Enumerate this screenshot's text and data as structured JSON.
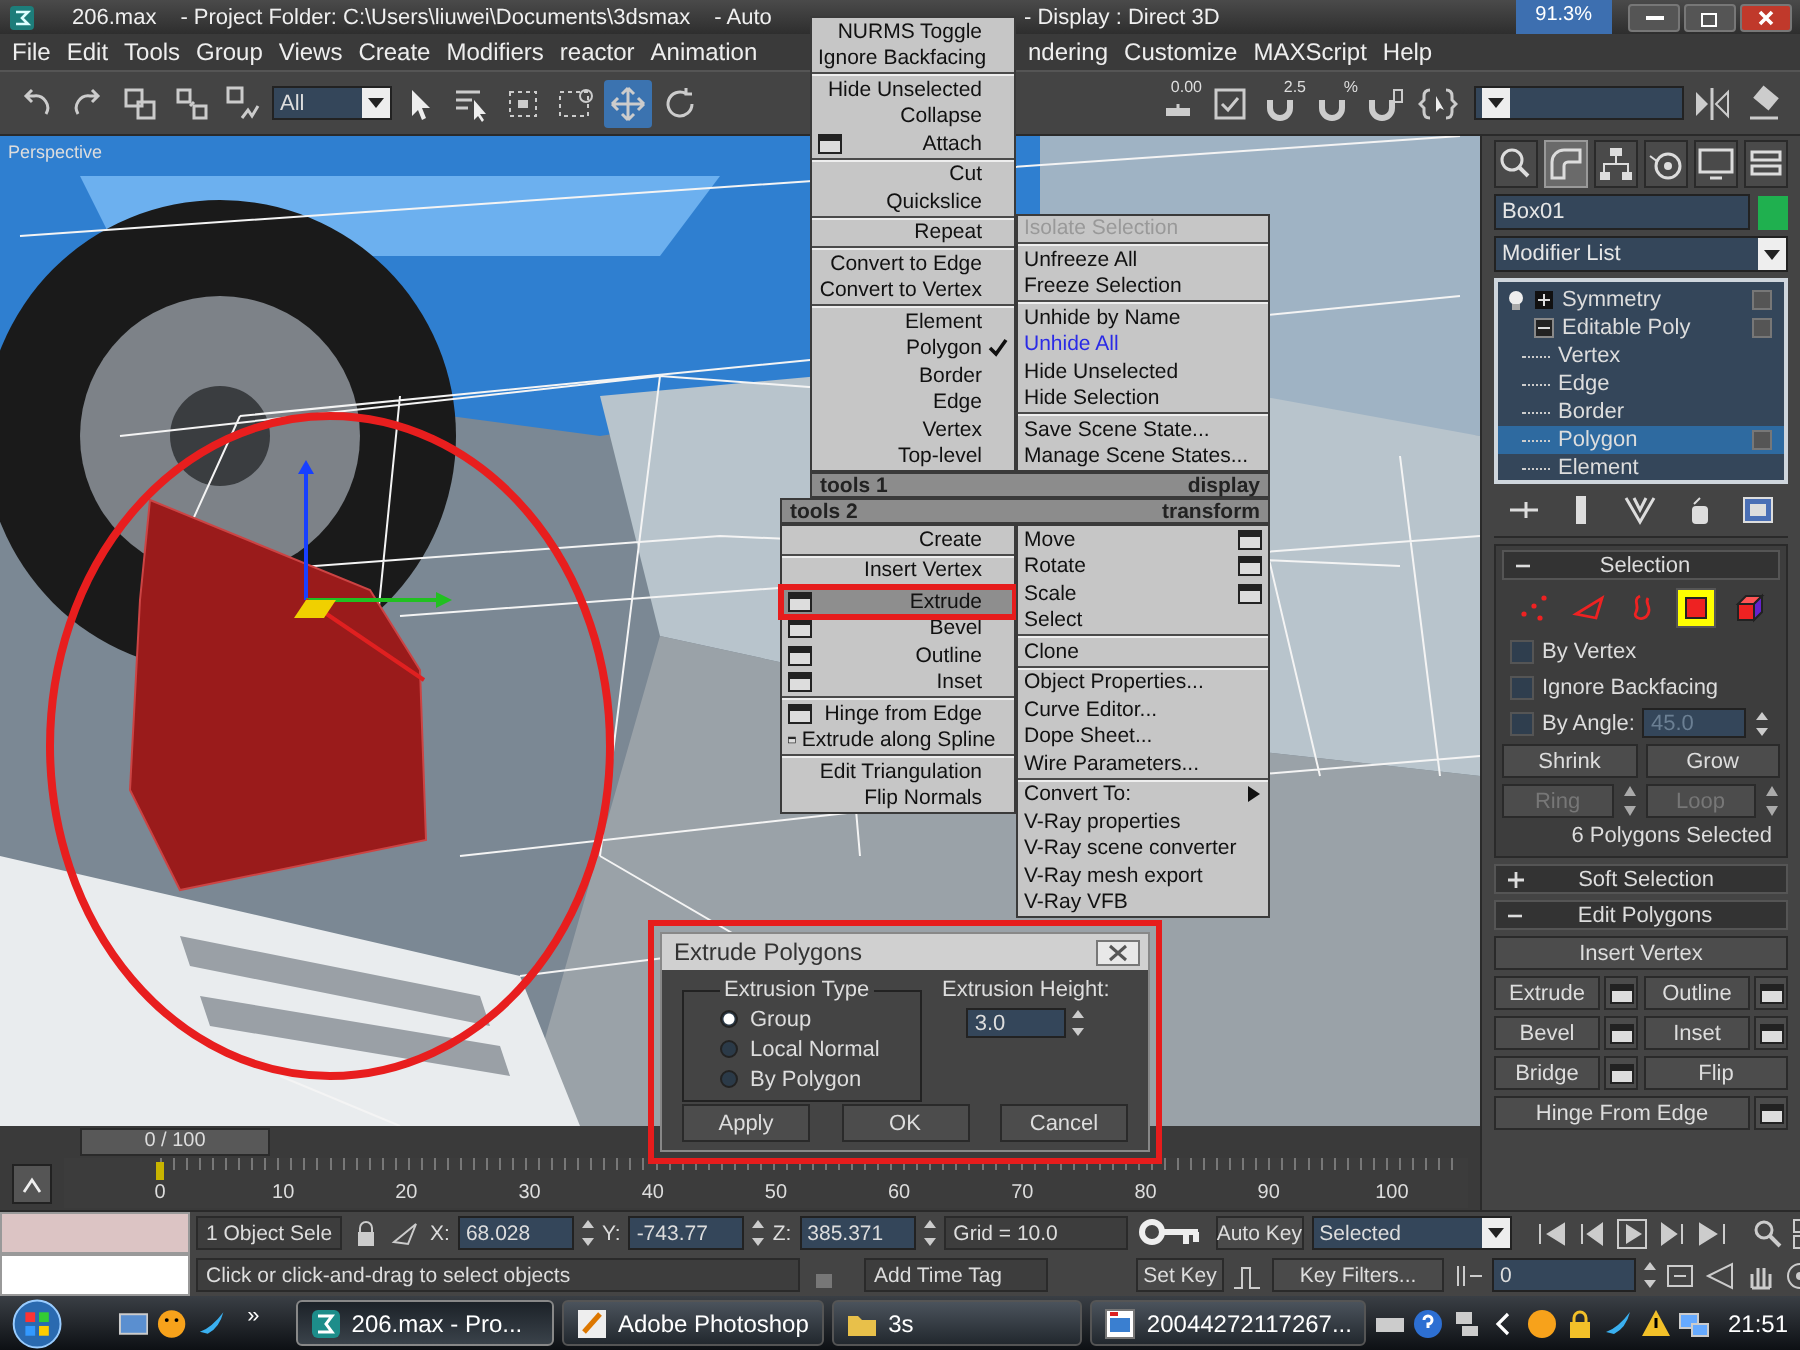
{
  "title_bar": {
    "left_segments": [
      "206.max",
      "- Project Folder: C:\\Users\\liuwei\\Documents\\3dsmax",
      "- Auto"
    ],
    "right_segments": [
      "- Display : Direct 3D"
    ],
    "badge": "91.3%"
  },
  "menu_bar": {
    "items_left": [
      "File",
      "Edit",
      "Tools",
      "Group",
      "Views",
      "Create",
      "Modifiers",
      "reactor",
      "Animation"
    ],
    "items_right": [
      "ndering",
      "Customize",
      "MAXScript",
      "Help"
    ]
  },
  "toolbar": {
    "left_tools": [
      {
        "kind": "undo",
        "selected": false
      },
      {
        "kind": "redo",
        "selected": false
      },
      {
        "kind": "link",
        "selected": false
      },
      {
        "kind": "unlink",
        "selected": false
      },
      {
        "kind": "bind",
        "selected": false
      },
      {
        "kind": "filter",
        "value": "All",
        "selected": false
      },
      {
        "kind": "select",
        "selected": false
      },
      {
        "kind": "select_by_name",
        "selected": false
      },
      {
        "kind": "region",
        "selected": false
      },
      {
        "kind": "crossing",
        "selected": false
      },
      {
        "kind": "move",
        "selected": true
      },
      {
        "kind": "rotate",
        "selected": false
      }
    ],
    "right_tools": [
      {
        "kind": "spinner",
        "label": "0.00",
        "selected": false
      },
      {
        "kind": "check",
        "selected": false
      },
      {
        "kind": "angle_snap",
        "label": "2.5",
        "selected": false
      },
      {
        "kind": "percent_snap",
        "label": "%",
        "selected": false
      },
      {
        "kind": "magnet",
        "selected": false
      },
      {
        "kind": "named_sel",
        "selected": false
      },
      {
        "kind": "named_field",
        "selected": false
      },
      {
        "kind": "mirror",
        "selected": false
      },
      {
        "kind": "align",
        "selected": false
      }
    ]
  },
  "viewport": {
    "label": "Perspective"
  },
  "quad_menu": {
    "upper_left": [
      [
        {
          "label": "NURMS Toggle",
          "kind": "item",
          "selected": false
        },
        {
          "label": "Ignore Backfacing",
          "kind": "item",
          "selected": false
        }
      ],
      [
        {
          "label": "Hide Unselected",
          "kind": "item",
          "selected": false
        },
        {
          "label": "Collapse",
          "kind": "item",
          "selected": false
        },
        {
          "label": "Attach",
          "kind": "options",
          "selected": false
        }
      ],
      [
        {
          "label": "Cut",
          "kind": "item",
          "selected": false
        },
        {
          "label": "Quickslice",
          "kind": "item",
          "selected": false
        }
      ],
      [
        {
          "label": "Repeat",
          "kind": "item",
          "selected": false
        }
      ],
      [
        {
          "label": "Convert to Edge",
          "kind": "item",
          "selected": false
        },
        {
          "label": "Convert to Vertex",
          "kind": "item",
          "selected": false
        }
      ],
      [
        {
          "label": "Element",
          "kind": "item",
          "selected": false,
          "checked": false
        },
        {
          "label": "Polygon",
          "kind": "item",
          "selected": false,
          "checked": true
        },
        {
          "label": "Border",
          "kind": "item",
          "selected": false,
          "checked": false
        },
        {
          "label": "Edge",
          "kind": "item",
          "selected": false,
          "checked": false
        },
        {
          "label": "Vertex",
          "kind": "item",
          "selected": false,
          "checked": false
        },
        {
          "label": "Top-level",
          "kind": "item",
          "selected": false,
          "checked": false
        }
      ]
    ],
    "upper_right": [
      [
        {
          "label": "Isolate Selection",
          "kind": "item",
          "selected": false,
          "disabled": true
        }
      ],
      [
        {
          "label": "Unfreeze All",
          "kind": "item",
          "selected": false
        },
        {
          "label": "Freeze Selection",
          "kind": "item",
          "selected": false
        }
      ],
      [
        {
          "label": "Unhide by Name",
          "kind": "item",
          "selected": false,
          "last_used": false
        },
        {
          "label": "Unhide All",
          "kind": "item",
          "selected": false,
          "last_used": true
        },
        {
          "label": "Hide Unselected",
          "kind": "item",
          "selected": false,
          "last_used": false
        },
        {
          "label": "Hide Selection",
          "kind": "item",
          "selected": false,
          "last_used": false
        }
      ],
      [
        {
          "label": "Save Scene State...",
          "kind": "item",
          "selected": false
        },
        {
          "label": "Manage Scene States...",
          "kind": "item",
          "selected": false
        }
      ]
    ],
    "headers": [
      {
        "left": "tools 1",
        "right": "display"
      },
      {
        "left": "tools 2",
        "right": "transform"
      }
    ],
    "lower_left": [
      [
        {
          "label": "Create",
          "kind": "item",
          "selected": false
        }
      ],
      [
        {
          "label": "Insert Vertex",
          "kind": "item",
          "selected": false
        }
      ],
      [
        {
          "label": "Extrude",
          "kind": "options",
          "selected": true
        },
        {
          "label": "Bevel",
          "kind": "options",
          "selected": false
        },
        {
          "label": "Outline",
          "kind": "options",
          "selected": false
        },
        {
          "label": "Inset",
          "kind": "options",
          "selected": false
        }
      ],
      [
        {
          "label": "Hinge from Edge",
          "kind": "options",
          "selected": false
        },
        {
          "label": "Extrude along Spline",
          "kind": "options",
          "selected": false
        }
      ],
      [
        {
          "label": "Edit Triangulation",
          "kind": "item",
          "selected": false
        },
        {
          "label": "Flip Normals",
          "kind": "item",
          "selected": false
        }
      ]
    ],
    "lower_right": [
      [
        {
          "label": "Move",
          "kind": "options",
          "selected": false
        },
        {
          "label": "Rotate",
          "kind": "options",
          "selected": false
        },
        {
          "label": "Scale",
          "kind": "options",
          "selected": false
        },
        {
          "label": "Select",
          "kind": "item",
          "selected": false
        }
      ],
      [
        {
          "label": "Clone",
          "kind": "item",
          "selected": false
        }
      ],
      [
        {
          "label": "Object Properties...",
          "kind": "item",
          "selected": false
        },
        {
          "label": "Curve Editor...",
          "kind": "item",
          "selected": false
        },
        {
          "label": "Dope Sheet...",
          "kind": "item",
          "selected": false
        },
        {
          "label": "Wire Parameters...",
          "kind": "item",
          "selected": false
        }
      ],
      [
        {
          "label": "Convert To:",
          "kind": "submenu",
          "selected": false
        },
        {
          "label": "V-Ray properties",
          "kind": "item",
          "selected": false
        },
        {
          "label": "V-Ray scene converter",
          "kind": "item",
          "selected": false
        },
        {
          "label": "V-Ray mesh export",
          "kind": "item",
          "selected": false
        },
        {
          "label": "V-Ray VFB",
          "kind": "item",
          "selected": false
        }
      ]
    ]
  },
  "command_panel": {
    "tabs": [
      {
        "kind": "create",
        "selected": false
      },
      {
        "kind": "modify",
        "selected": true
      },
      {
        "kind": "hierarchy",
        "selected": false
      },
      {
        "kind": "motion",
        "selected": false
      },
      {
        "kind": "display",
        "selected": false
      },
      {
        "kind": "utilities",
        "selected": false
      }
    ],
    "object_name": "Box01",
    "modifier_list": "Modifier List",
    "stack": [
      {
        "label": "Symmetry",
        "expanded": false,
        "selected": false
      },
      {
        "label": "Editable Poly",
        "expanded": true,
        "selected": false,
        "children": [
          {
            "label": "Vertex",
            "selected": false
          },
          {
            "label": "Edge",
            "selected": false
          },
          {
            "label": "Border",
            "selected": false
          },
          {
            "label": "Polygon",
            "selected": true
          },
          {
            "label": "Element",
            "selected": false
          }
        ]
      }
    ],
    "selection": {
      "title": "Selection",
      "expanded": true,
      "subobjects": [
        {
          "kind": "vertex",
          "selected": false
        },
        {
          "kind": "edge",
          "selected": false
        },
        {
          "kind": "border",
          "selected": false
        },
        {
          "kind": "polygon",
          "selected": true
        },
        {
          "kind": "element",
          "selected": false
        }
      ],
      "options": [
        {
          "label": "By Vertex",
          "checked": false
        },
        {
          "label": "Ignore Backfacing",
          "checked": false
        },
        {
          "label": "By Angle:",
          "checked": false
        }
      ],
      "angle_value": "45.0",
      "buttons": [
        {
          "label": "Shrink",
          "disabled": false
        },
        {
          "label": "Grow",
          "disabled": false
        },
        {
          "label": "Ring",
          "disabled": true
        },
        {
          "label": "Loop",
          "disabled": true
        }
      ],
      "status": "6 Polygons Selected"
    },
    "rollouts": [
      {
        "title": "Soft Selection",
        "expanded": false
      },
      {
        "title": "Edit Polygons",
        "expanded": true
      }
    ],
    "edit_polygons": [
      {
        "label": "Insert Vertex",
        "kind": "wide",
        "options": false
      },
      {
        "label": "Extrude",
        "kind": "half",
        "options": true
      },
      {
        "label": "Outline",
        "kind": "half",
        "options": true
      },
      {
        "label": "Bevel",
        "kind": "half",
        "options": true
      },
      {
        "label": "Inset",
        "kind": "half",
        "options": true
      },
      {
        "label": "Bridge",
        "kind": "half",
        "options": true
      },
      {
        "label": "Flip",
        "kind": "half",
        "options": false
      },
      {
        "label": "Hinge From Edge",
        "kind": "wide",
        "options": true
      }
    ]
  },
  "time_slider": {
    "label": "0 / 100",
    "ticks": [
      "0",
      "10",
      "20",
      "30",
      "40",
      "50",
      "60",
      "70",
      "80",
      "90",
      "100"
    ]
  },
  "status_bar": {
    "selection": "1 Object Sele",
    "coords": [
      {
        "label": "X:",
        "value": "68.028"
      },
      {
        "label": "Y:",
        "value": "-743.77"
      },
      {
        "label": "Z:",
        "value": "385.371"
      }
    ],
    "grid": "Grid = 10.0",
    "prompt": "Click or click-and-drag to select objects",
    "time_tag": "Add Time Tag",
    "auto_key": "Auto Key",
    "set_key": "Set Key",
    "key_mode": "Selected",
    "key_filters": "Key Filters...",
    "frame": "0"
  },
  "dialog": {
    "title": "Extrude Polygons",
    "group_title": "Extrusion Type",
    "options": [
      {
        "label": "Group",
        "selected": true
      },
      {
        "label": "Local Normal",
        "selected": false
      },
      {
        "label": "By Polygon",
        "selected": false
      }
    ],
    "height_label": "Extrusion Height:",
    "height_value": "3.0",
    "buttons": [
      "Apply",
      "OK",
      "Cancel"
    ]
  },
  "taskbar": {
    "overflow": "»",
    "tasks": [
      {
        "kind": "max",
        "label": "206.max - Pro...",
        "selected": true
      },
      {
        "kind": "photoshop",
        "label": "Adobe Photoshop",
        "selected": false
      },
      {
        "kind": "folder",
        "label": "3s",
        "selected": false
      },
      {
        "kind": "image",
        "label": "20044272117267...",
        "selected": false
      }
    ],
    "clock": "21:51"
  }
}
